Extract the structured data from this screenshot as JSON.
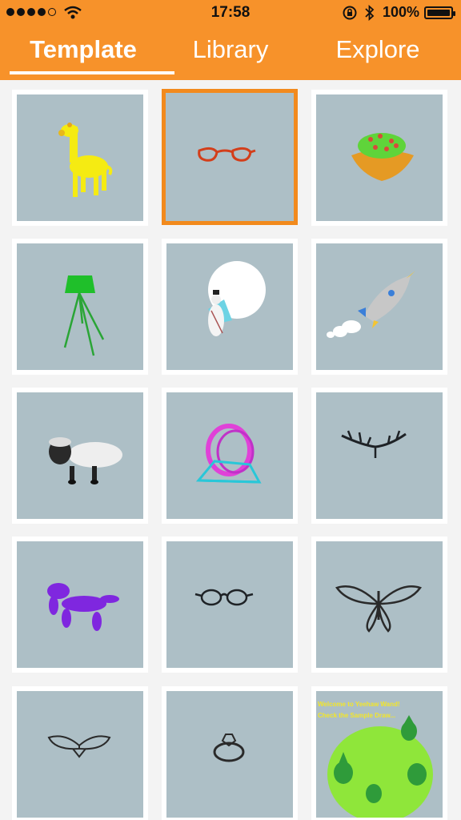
{
  "status": {
    "time": "17:58",
    "battery": "100%",
    "signal_icon": "signal-dots-icon",
    "wifi_icon": "wifi-icon",
    "rotation_lock_icon": "rotation-lock-icon",
    "bluetooth_icon": "bluetooth-icon",
    "battery_icon": "battery-icon"
  },
  "tabs": [
    {
      "label": "Template"
    },
    {
      "label": "Library"
    },
    {
      "label": "Explore"
    }
  ],
  "grid": {
    "selected_index": 1,
    "items": [
      {
        "icon": "giraffe-icon"
      },
      {
        "icon": "glasses-icon"
      },
      {
        "icon": "bird-nest-icon"
      },
      {
        "icon": "floor-lamp-icon"
      },
      {
        "icon": "snowman-icon"
      },
      {
        "icon": "rocket-icon"
      },
      {
        "icon": "sheep-icon"
      },
      {
        "icon": "hamster-wheel-icon"
      },
      {
        "icon": "branch-ornament-icon"
      },
      {
        "icon": "balloon-dog-icon"
      },
      {
        "icon": "round-glasses-icon"
      },
      {
        "icon": "butterfly-icon"
      },
      {
        "icon": "winged-ornament-icon"
      },
      {
        "icon": "diamond-ring-icon"
      },
      {
        "icon": "planet-trees-icon",
        "line1": "Welcome to Yeehaw Wand!",
        "line2": "Check the Sample Draw..."
      }
    ]
  },
  "colors": {
    "accent": "#f7922a",
    "selection": "#f28a1d",
    "thumb_bg": "#adbfc6"
  }
}
